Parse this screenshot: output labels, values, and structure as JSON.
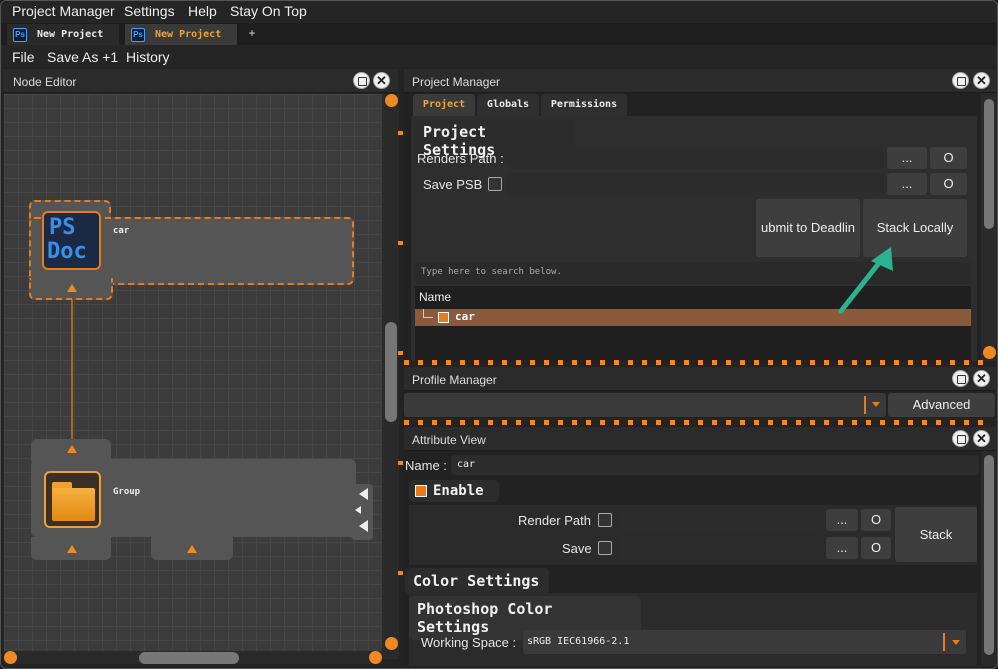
{
  "menubar": {
    "items": [
      "Project Manager",
      "Settings",
      "Help",
      "Stay On Top"
    ]
  },
  "tabs": [
    {
      "icon": "Ps",
      "label": "New Project"
    },
    {
      "icon": "Ps",
      "label": "New Project"
    }
  ],
  "add_tab": "+",
  "toolbar": {
    "items": [
      "File",
      "Save As +1",
      "History"
    ]
  },
  "node_editor": {
    "title": "Node Editor",
    "nodes": [
      {
        "icon_text_1": "PS",
        "icon_text_2": "Doc",
        "label": "car"
      },
      {
        "icon": "folder-icon",
        "label": "Group"
      }
    ]
  },
  "project_manager": {
    "title": "Project Manager",
    "tabs": [
      "Project",
      "Globals",
      "Permissions"
    ],
    "section_title": "Project Settings",
    "renders_path_label": "Renders Path :",
    "save_psb_label": "Save PSB",
    "browse_label": "...",
    "open_label": "O",
    "submit_deadline_label": "ubmit to Deadlin",
    "stack_locally_label": "Stack Locally",
    "search_placeholder": "Type here to search below.",
    "tree_header": "Name",
    "tree_items": [
      {
        "label": "car"
      }
    ]
  },
  "profile_manager": {
    "title": "Profile Manager",
    "advanced_label": "Advanced"
  },
  "attribute_view": {
    "title": "Attribute View",
    "name_label": "Name :",
    "name_value": "car",
    "enable_label": "Enable",
    "render_path_label": "Render Path",
    "save_label": "Save",
    "browse_label": "...",
    "open_label": "O",
    "stack_label": "Stack",
    "color_settings_title": "Color Settings",
    "photoshop_color_title": "Photoshop Color Settings",
    "working_space_label": "Working Space :",
    "working_space_value": "sRGB IEC61966-2.1"
  },
  "colors": {
    "accent": "#f08a20",
    "selection": "#8a5a3a",
    "arrow": "#2bb38f"
  }
}
